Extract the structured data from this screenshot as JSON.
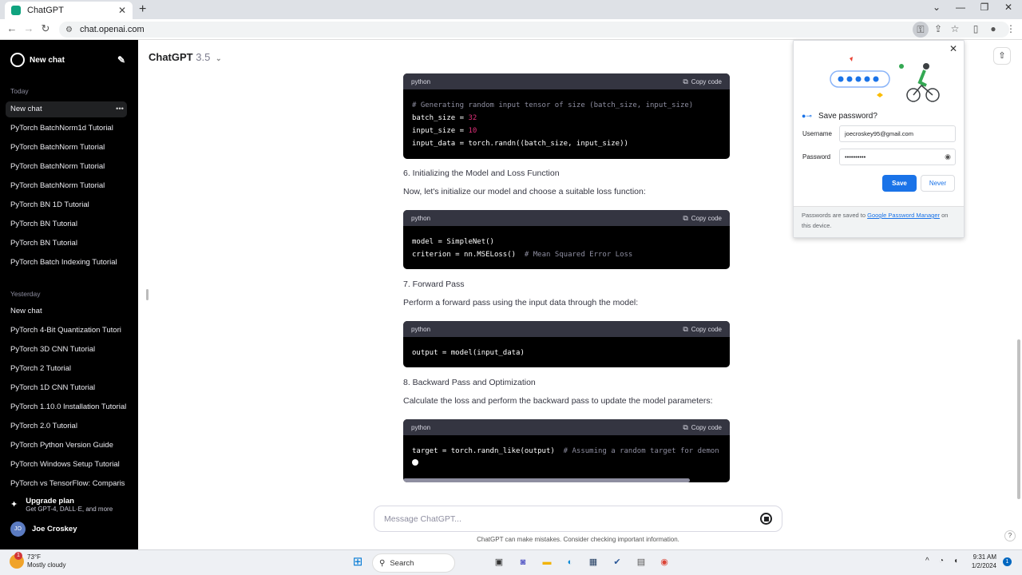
{
  "browser": {
    "tab_title": "ChatGPT",
    "url": "chat.openai.com"
  },
  "sidebar": {
    "new_chat_label": "New chat",
    "today_label": "Today",
    "today_items": [
      "New chat",
      "PyTorch BatchNorm1d Tutorial",
      "PyTorch BatchNorm Tutorial",
      "PyTorch BatchNorm Tutorial",
      "PyTorch BatchNorm Tutorial",
      "PyTorch BN 1D Tutorial",
      "PyTorch BN Tutorial",
      "PyTorch BN Tutorial",
      "PyTorch Batch Indexing Tutorial"
    ],
    "yesterday_label": "Yesterday",
    "yesterday_items": [
      "New chat",
      "PyTorch 4-Bit Quantization Tutori",
      "PyTorch 3D CNN Tutorial",
      "PyTorch 2 Tutorial",
      "PyTorch 1D CNN Tutorial",
      "PyTorch 1.10.0 Installation Tutorial",
      "PyTorch 2.0 Tutorial",
      "PyTorch Python Version Guide",
      "PyTorch Windows Setup Tutorial",
      "PyTorch vs TensorFlow: Comparis"
    ],
    "upgrade_title": "Upgrade plan",
    "upgrade_sub": "Get GPT-4, DALL·E, and more",
    "user_initials": "JO",
    "user_name": "Joe Croskey"
  },
  "main": {
    "model_name": "ChatGPT",
    "model_version": "3.5",
    "code_lang": "python",
    "copy_label": "Copy code",
    "block1": {
      "line1": "# Generating random input tensor of size (batch_size, input_size)",
      "line2a": "batch_size = ",
      "line2b": "32",
      "line3a": "input_size = ",
      "line3b": "10",
      "line4": "input_data = torch.randn((batch_size, input_size))"
    },
    "h6": "6. Initializing the Model and Loss Function",
    "p6": "Now, let's initialize our model and choose a suitable loss function:",
    "block2": {
      "line1": "model = SimpleNet()",
      "line2a": "criterion = nn.MSELoss()  ",
      "line2b": "# Mean Squared Error Loss"
    },
    "h7": "7. Forward Pass",
    "p7": "Perform a forward pass using the input data through the model:",
    "block3": {
      "line1": "output = model(input_data)"
    },
    "h8": "8. Backward Pass and Optimization",
    "p8": "Calculate the loss and perform the backward pass to update the model parameters:",
    "block4": {
      "line1a": "target = torch.randn_like(output)  ",
      "line1b": "# Assuming a random target for demon"
    },
    "composer_placeholder": "Message ChatGPT...",
    "disclaimer": "ChatGPT can make mistakes. Consider checking important information.",
    "help": "?"
  },
  "password_popup": {
    "title": "Save password?",
    "username_label": "Username",
    "username_value": "joecroskey95@gmail.com",
    "password_label": "Password",
    "password_value": "••••••••••",
    "save_label": "Save",
    "never_label": "Never",
    "footer_text_a": "Passwords are saved to ",
    "footer_link": "Google Password Manager",
    "footer_text_b": " on this device."
  },
  "taskbar": {
    "weather_temp": "73°F",
    "weather_desc": "Mostly cloudy",
    "weather_badge": "1",
    "search_label": "Search",
    "time": "9:31 AM",
    "date": "1/2/2024",
    "notif_count": "1"
  },
  "colors": {
    "sidebar_bg": "#000000",
    "code_bg": "#000000",
    "code_header_bg": "#343541",
    "accent_blue": "#1a73e8",
    "number_pink": "#df3079"
  }
}
